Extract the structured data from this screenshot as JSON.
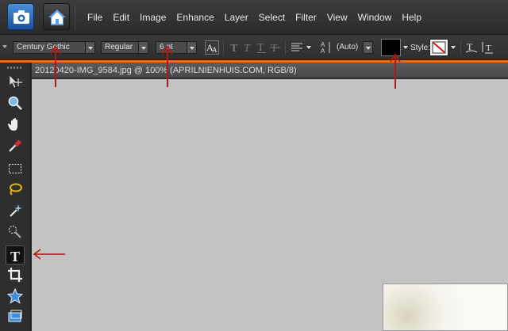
{
  "menubar": {
    "items": [
      "File",
      "Edit",
      "Image",
      "Enhance",
      "Layer",
      "Select",
      "Filter",
      "View",
      "Window",
      "Help"
    ]
  },
  "options": {
    "font_family": "Century Gothic",
    "font_style": "Regular",
    "font_size": "6 pt",
    "leading": "(Auto)",
    "style_label": "Style:",
    "text_color": "#000000"
  },
  "document": {
    "title": "20120420-IMG_9584.jpg @ 100% (APRILNIENHUIS.COM, RGB/8)"
  },
  "tools": [
    "move-tool",
    "zoom-tool",
    "hand-tool",
    "eyedropper-tool",
    "marquee-tool",
    "lasso-tool",
    "magic-wand-tool",
    "quick-selection-tool",
    "type-tool",
    "crop-tool",
    "cookie-cutter-tool",
    "straighten-tool"
  ],
  "colors": {
    "accent_orange": "#e8701c",
    "annotation_red": "#b01818",
    "canvas_gray": "#c3c3c3",
    "ui_dark": "#2e2e2e"
  }
}
